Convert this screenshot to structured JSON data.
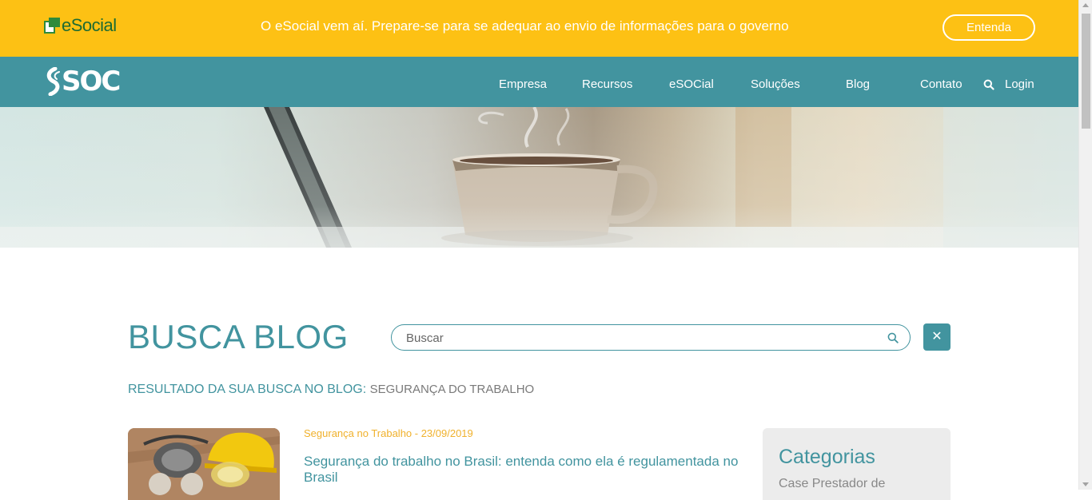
{
  "topbar": {
    "logo_text": "eSocial",
    "banner_text": "O eSocial vem aí. Prepare-se para se adequar ao envio de informações para o governo",
    "cta_label": "Entenda",
    "background": "#fdc114"
  },
  "navbar": {
    "logo_text": "SOC",
    "background": "#42949f",
    "items": [
      {
        "label": "Empresa"
      },
      {
        "label": "Recursos"
      },
      {
        "label": "eSOCial"
      },
      {
        "label": "Soluções"
      },
      {
        "label": "Blog"
      },
      {
        "label": "Contato"
      }
    ],
    "login_label": "Login",
    "search_icon": "search-icon"
  },
  "search": {
    "title": "BUSCA BLOG",
    "placeholder": "Buscar",
    "search_icon": "search-icon",
    "clear_icon": "close-icon",
    "clear_glyph": "✕"
  },
  "results": {
    "label": "RESULTADO DA SUA BUSCA NO BLOG:",
    "term": "SEGURANÇA DO TRABALHO"
  },
  "posts": [
    {
      "meta": "Segurança no Trabalho - 23/09/2019",
      "title": "Segurança do trabalho no Brasil: entenda como ela é regulamentada no Brasil"
    }
  ],
  "sidebar": {
    "title": "Categorias",
    "items": [
      {
        "label": "Case Prestador de"
      }
    ]
  },
  "colors": {
    "accent": "#42949f",
    "banner": "#fdc114",
    "meta": "#f0b12c"
  }
}
